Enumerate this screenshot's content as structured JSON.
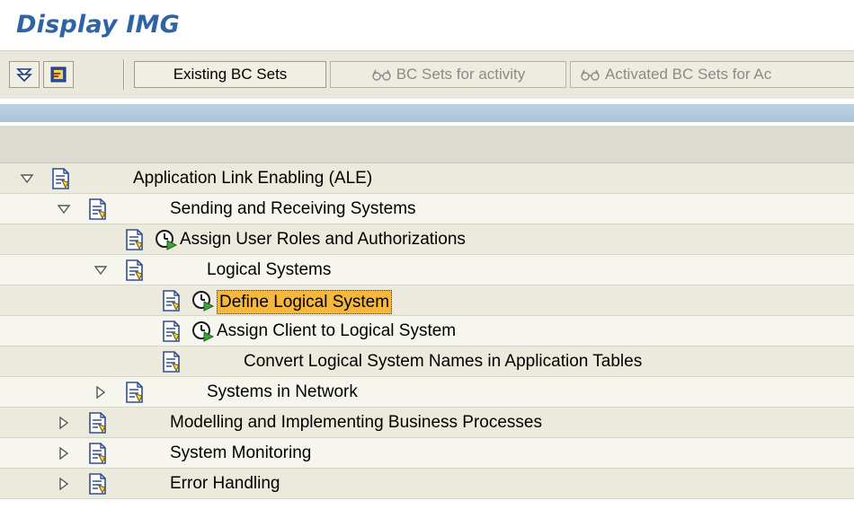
{
  "window": {
    "title": "Display IMG"
  },
  "toolbar": {
    "buttons": [
      {
        "label": "Existing BC Sets",
        "enabled": true
      },
      {
        "label": "BC Sets for activity",
        "enabled": false
      },
      {
        "label": "Activated BC Sets for Ac",
        "enabled": false
      }
    ]
  },
  "icons": {
    "expand": "triangle-down-icon",
    "collapse": "triangle-right-icon",
    "node": "document-icon",
    "activity": "clock-execute-icon",
    "bcset": "glasses-icon"
  },
  "colors": {
    "title": "#2e63a4",
    "selection": "#f5b83d",
    "blue_bar": "#b3cade",
    "toolbar": "#eae8dc",
    "row": "#eceadd",
    "row_alt": "#f7f6ee"
  },
  "tree": [
    {
      "label": "Application Link Enabling (ALE)",
      "state": "expanded",
      "level": 0,
      "has_clock": false,
      "selected": false
    },
    {
      "label": "Sending and Receiving Systems",
      "state": "expanded",
      "level": 1,
      "has_clock": false,
      "selected": false
    },
    {
      "label": "Assign User Roles and Authorizations",
      "state": "leaf",
      "level": 2,
      "has_clock": true,
      "selected": false
    },
    {
      "label": "Logical Systems",
      "state": "expanded",
      "level": 2,
      "has_clock": false,
      "selected": false
    },
    {
      "label": "Define Logical System",
      "state": "leaf",
      "level": 3,
      "has_clock": true,
      "selected": true
    },
    {
      "label": "Assign Client to Logical System",
      "state": "leaf",
      "level": 3,
      "has_clock": true,
      "selected": false
    },
    {
      "label": "Convert Logical System Names in Application Tables",
      "state": "leaf",
      "level": 3,
      "has_clock": false,
      "selected": false
    },
    {
      "label": "Systems in Network",
      "state": "collapsed",
      "level": 2,
      "has_clock": false,
      "selected": false
    },
    {
      "label": "Modelling and Implementing Business Processes",
      "state": "collapsed",
      "level": 1,
      "has_clock": false,
      "selected": false
    },
    {
      "label": "System Monitoring",
      "state": "collapsed",
      "level": 1,
      "has_clock": false,
      "selected": false
    },
    {
      "label": "Error Handling",
      "state": "collapsed",
      "level": 1,
      "has_clock": false,
      "selected": false
    }
  ]
}
